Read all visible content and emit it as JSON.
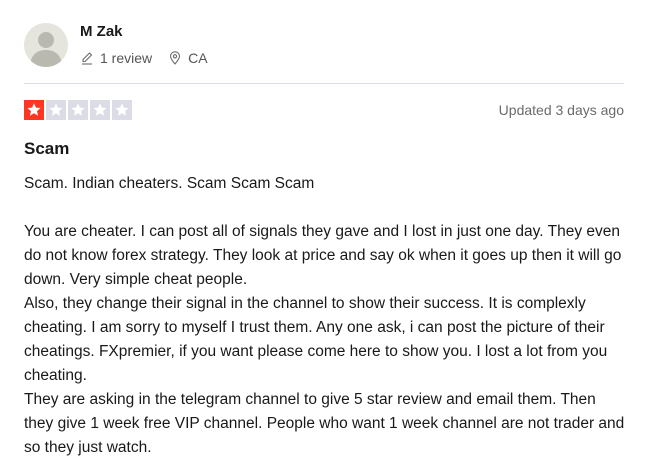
{
  "reviewer": {
    "name": "M Zak",
    "review_count": "1 review",
    "location": "CA",
    "avatar_icon": "user-silhouette-icon",
    "count_icon": "pencil-icon",
    "location_icon": "map-pin-icon"
  },
  "rating": {
    "stars_filled": 1,
    "stars_total": 5,
    "filled_color": "#ff3722",
    "empty_color": "#dcdce6",
    "updated": "Updated 3 days ago"
  },
  "review": {
    "title": "Scam",
    "summary": "Scam. Indian cheaters. Scam Scam Scam",
    "paragraphs": [
      "You are cheater. I can post all of signals they gave and I lost in just one day. They even do not know forex strategy. They look at price and say ok when it goes up then it will go down. Very simple cheat people.",
      "Also, they change their signal in the channel to show their success. It is complexly cheating. I am sorry to myself I trust them. Any one ask, i can post the picture of their cheatings. FXpremier, if you want please come here to show you. I lost a lot from you cheating.",
      "They are asking in the telegram channel to give 5 star review and email them. Then they give 1 week free VIP channel. People who want 1 week channel are not trader and so they just watch."
    ]
  }
}
